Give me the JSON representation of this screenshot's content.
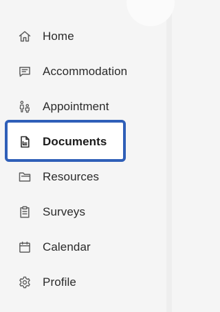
{
  "sidebar": {
    "items": [
      {
        "label": "Home",
        "icon": "home-icon"
      },
      {
        "label": "Accommodation",
        "icon": "message-icon"
      },
      {
        "label": "Appointment",
        "icon": "people-icon"
      },
      {
        "label": "Documents",
        "icon": "document-icon",
        "active": true
      },
      {
        "label": "Resources",
        "icon": "folder-icon"
      },
      {
        "label": "Surveys",
        "icon": "clipboard-icon"
      },
      {
        "label": "Calendar",
        "icon": "calendar-icon"
      },
      {
        "label": "Profile",
        "icon": "gear-icon"
      }
    ]
  },
  "colors": {
    "background": "#f5f5f5",
    "focus_ring": "#2f5fb8",
    "text": "#2a2a2a",
    "icon": "#5e5e5e"
  }
}
